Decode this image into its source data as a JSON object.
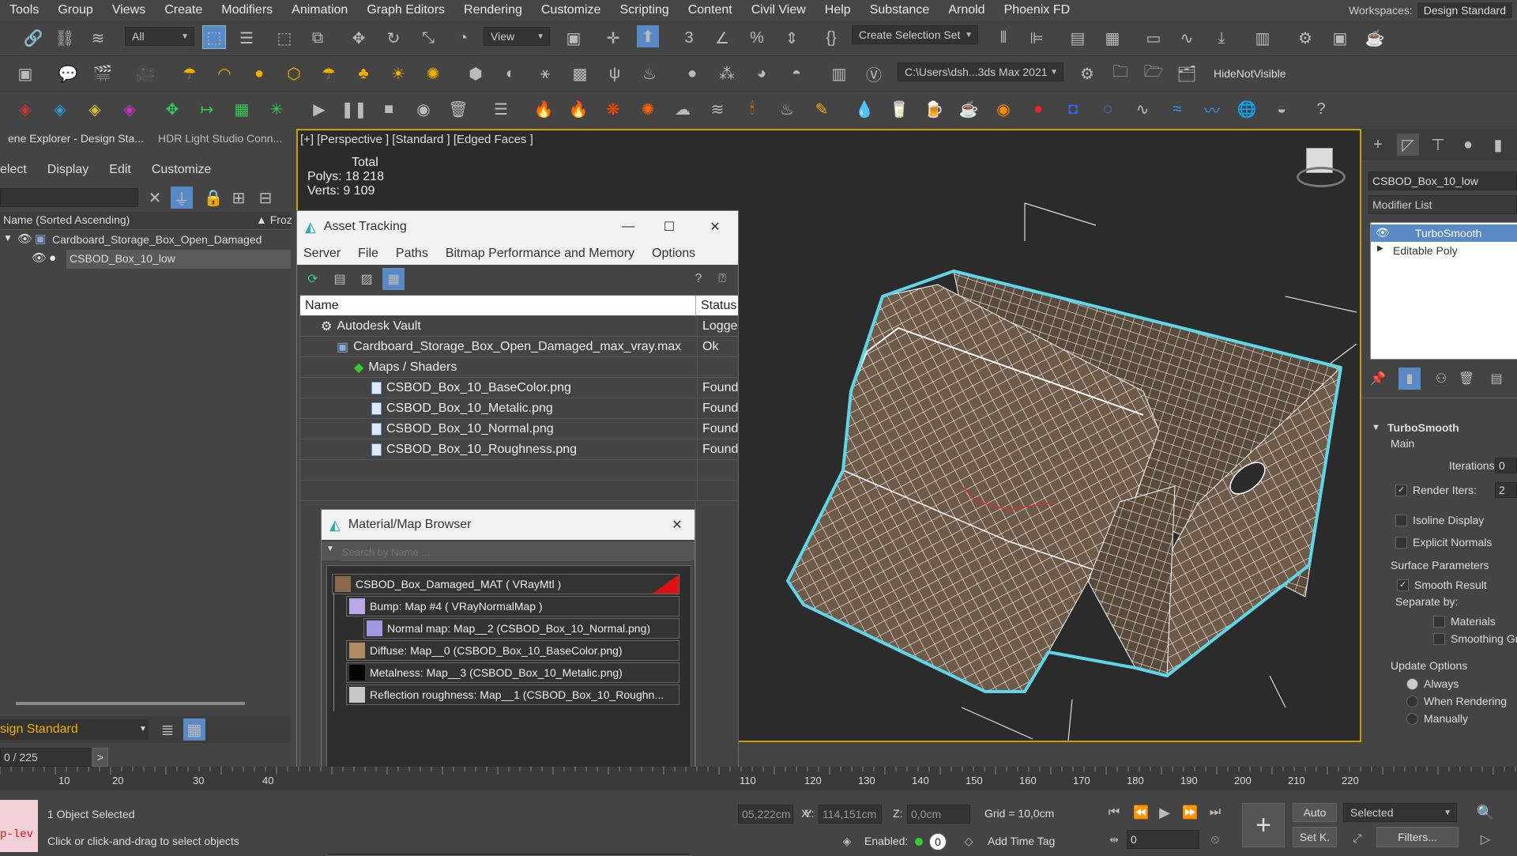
{
  "menu": [
    "Tools",
    "Group",
    "Views",
    "Create",
    "Modifiers",
    "Animation",
    "Graph Editors",
    "Rendering",
    "Customize",
    "Scripting",
    "Content",
    "Civil View",
    "Help",
    "Substance",
    "Arnold",
    "Phoenix FD"
  ],
  "workspaces": {
    "label": "Workspaces:",
    "value": "Design Standard"
  },
  "toolbar": {
    "filter": "All",
    "ref_coord": "View",
    "selection_set": "Create Selection Set",
    "project_path": "C:\\Users\\dsh...3ds Max 2021",
    "hide_not_visible": "HideNotVisible"
  },
  "scene_explorer": {
    "tab1": "ene Explorer - Design Sta...",
    "tab2": "HDR Light Studio Conn...",
    "menu": [
      "elect",
      "Display",
      "Edit",
      "Customize"
    ],
    "col_name": "Name (Sorted Ascending)",
    "col_froz": "▲ Froz",
    "items": [
      "Cardboard_Storage_Box_Open_Damaged",
      "CSBOD_Box_10_low"
    ],
    "layer": "sign Standard",
    "frame": "0 / 225",
    "frame_arrow": ">"
  },
  "viewport": {
    "label": "[+] [Perspective ] [Standard ] [Edged Faces ]",
    "stats_total": "Total",
    "polys_label": "Polys:",
    "polys": "18 218",
    "verts_label": "Verts:",
    "verts": "9 109"
  },
  "asset_tracking": {
    "title": "Asset Tracking",
    "menu": [
      "Server",
      "File",
      "Paths",
      "Bitmap Performance and Memory",
      "Options"
    ],
    "col_name": "Name",
    "col_status": "Status",
    "rows": [
      {
        "name": "Autodesk Vault",
        "status": "Logge",
        "indent": 1,
        "icon": "vault"
      },
      {
        "name": "Cardboard_Storage_Box_Open_Damaged_max_vray.max",
        "status": "Ok",
        "indent": 2,
        "icon": "max"
      },
      {
        "name": "Maps / Shaders",
        "status": "",
        "indent": 3,
        "icon": "maps"
      },
      {
        "name": "CSBOD_Box_10_BaseColor.png",
        "status": "Found",
        "indent": 4,
        "icon": "file"
      },
      {
        "name": "CSBOD_Box_10_Metalic.png",
        "status": "Found",
        "indent": 4,
        "icon": "file"
      },
      {
        "name": "CSBOD_Box_10_Normal.png",
        "status": "Found",
        "indent": 4,
        "icon": "file"
      },
      {
        "name": "CSBOD_Box_10_Roughness.png",
        "status": "Found",
        "indent": 4,
        "icon": "file"
      }
    ]
  },
  "material_browser": {
    "title": "Material/Map Browser",
    "search_placeholder": "Search by Name ...",
    "items": [
      {
        "label": "CSBOD_Box_Damaged_MAT  ( VRayMtl )",
        "indent": 0,
        "swatch": "#8a6a4a"
      },
      {
        "label": "Bump: Map #4  ( VRayNormalMap )",
        "indent": 1,
        "swatch": "#b8a8e8"
      },
      {
        "label": "Normal map: Map__2 (CSBOD_Box_10_Normal.png)",
        "indent": 2,
        "swatch": "#a098e0"
      },
      {
        "label": "Diffuse: Map__0 (CSBOD_Box_10_BaseColor.png)",
        "indent": 1,
        "swatch": "#b08a60"
      },
      {
        "label": "Metalness: Map__3 (CSBOD_Box_10_Metalic.png)",
        "indent": 1,
        "swatch": "#050505"
      },
      {
        "label": "Reflection  roughness:  Map__1  (CSBOD_Box_10_Roughn...",
        "indent": 1,
        "swatch": "#c8c8c8"
      }
    ]
  },
  "command_panel": {
    "object_name": "CSBOD_Box_10_low",
    "modifier_list": "Modifier List",
    "stack": [
      "TurboSmooth",
      "Editable Poly"
    ],
    "rollout": "TurboSmooth",
    "main": "Main",
    "iterations_label": "Iterations:",
    "iterations": "0",
    "render_iters_label": "Render Iters:",
    "render_iters": "2",
    "isoline": "Isoline Display",
    "explicit": "Explicit Normals",
    "surface": "Surface Parameters",
    "smooth_result": "Smooth Result",
    "separate": "Separate by:",
    "materials": "Materials",
    "smoothing": "Smoothing Gr",
    "update": "Update Options",
    "always": "Always",
    "when_rendering": "When Rendering",
    "manually": "Manually"
  },
  "timeline": {
    "ticks": [
      "10",
      "20",
      "30",
      "40",
      "110",
      "120",
      "130",
      "140",
      "150",
      "160",
      "170",
      "180",
      "190",
      "200",
      "210",
      "220"
    ]
  },
  "status": {
    "selected": "1 Object Selected",
    "prompt": "Click or click-and-drag to select objects",
    "maxscript": "p-lev",
    "x_label": "X:",
    "x": "05,222cm",
    "y_label": "Y:",
    "y": "114,151cm",
    "z_label": "Z:",
    "z": "0,0cm",
    "grid": "Grid = 10,0cm",
    "enabled": "Enabled:",
    "add_time_tag": "Add Time Tag",
    "auto": "Auto",
    "selected_dd": "Selected",
    "setk": "Set K.",
    "filters": "Filters...",
    "frame": "0",
    "time_input": "0"
  }
}
